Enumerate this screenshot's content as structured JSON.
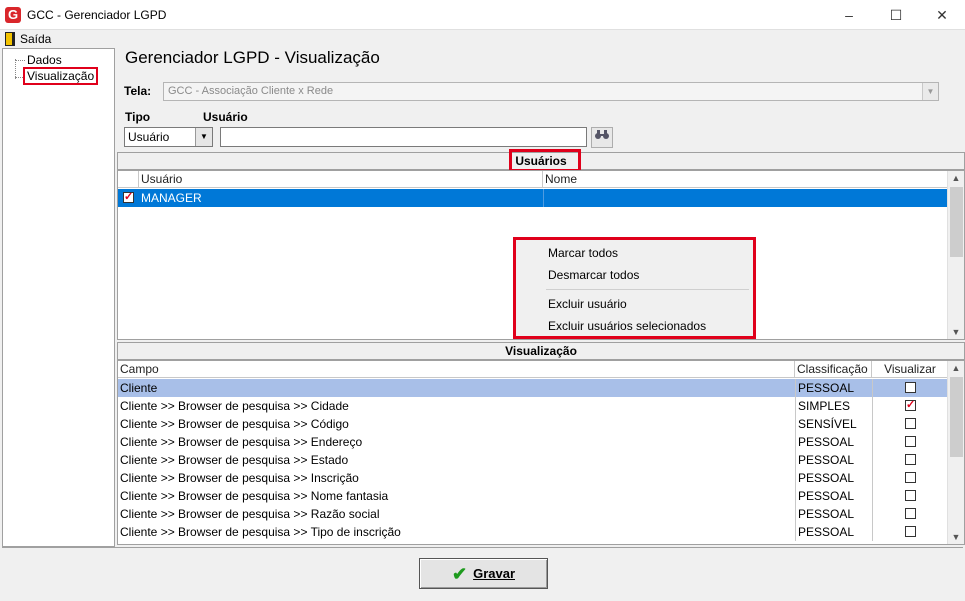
{
  "window": {
    "title": "GCC - Gerenciador LGPD",
    "logo": "G",
    "minimize": "–",
    "maximize": "☐",
    "close": "✕"
  },
  "menu": {
    "exit_label": "Saída"
  },
  "tree": {
    "items": [
      {
        "label": "Dados"
      },
      {
        "label": "Visualização",
        "selected": true
      }
    ]
  },
  "page": {
    "title": "Gerenciador LGPD - Visualização"
  },
  "filters": {
    "tela_label": "Tela:",
    "tela_value": "GCC - Associação Cliente x Rede",
    "tipo_label": "Tipo",
    "tipo_value": "Usuário",
    "usuario_label": "Usuário",
    "usuario_value": ""
  },
  "users_section": {
    "header": "Usuários",
    "columns": [
      "Usuário",
      "Nome"
    ],
    "rows": [
      {
        "checked": true,
        "usuario": "MANAGER",
        "nome": ""
      }
    ]
  },
  "context_menu": {
    "items": [
      "Marcar todos",
      "Desmarcar todos",
      "Excluir usuário",
      "Excluir usuários selecionados"
    ]
  },
  "view_section": {
    "header": "Visualização",
    "columns": [
      "Campo",
      "Classificação",
      "Visualizar"
    ],
    "rows": [
      {
        "campo": "Cliente",
        "classificacao": "PESSOAL",
        "visualizar": false
      },
      {
        "campo": "Cliente >> Browser de pesquisa >> Cidade",
        "classificacao": "SIMPLES",
        "visualizar": true
      },
      {
        "campo": "Cliente >> Browser de pesquisa >> Código",
        "classificacao": "SENSÍVEL",
        "visualizar": false
      },
      {
        "campo": "Cliente >> Browser de pesquisa >> Endereço",
        "classificacao": "PESSOAL",
        "visualizar": false
      },
      {
        "campo": "Cliente >> Browser de pesquisa >> Estado",
        "classificacao": "PESSOAL",
        "visualizar": false
      },
      {
        "campo": "Cliente >> Browser de pesquisa >> Inscrição",
        "classificacao": "PESSOAL",
        "visualizar": false
      },
      {
        "campo": "Cliente >> Browser de pesquisa >> Nome fantasia",
        "classificacao": "PESSOAL",
        "visualizar": false
      },
      {
        "campo": "Cliente >> Browser de pesquisa >> Razão social",
        "classificacao": "PESSOAL",
        "visualizar": false
      },
      {
        "campo": "Cliente >> Browser de pesquisa >> Tipo de inscrição",
        "classificacao": "PESSOAL",
        "visualizar": false
      }
    ]
  },
  "footer": {
    "save_label": "Gravar"
  },
  "colors": {
    "accent": "#0078d7",
    "highlight": "#e0001b",
    "row_highlight": "#a8bfe8"
  }
}
